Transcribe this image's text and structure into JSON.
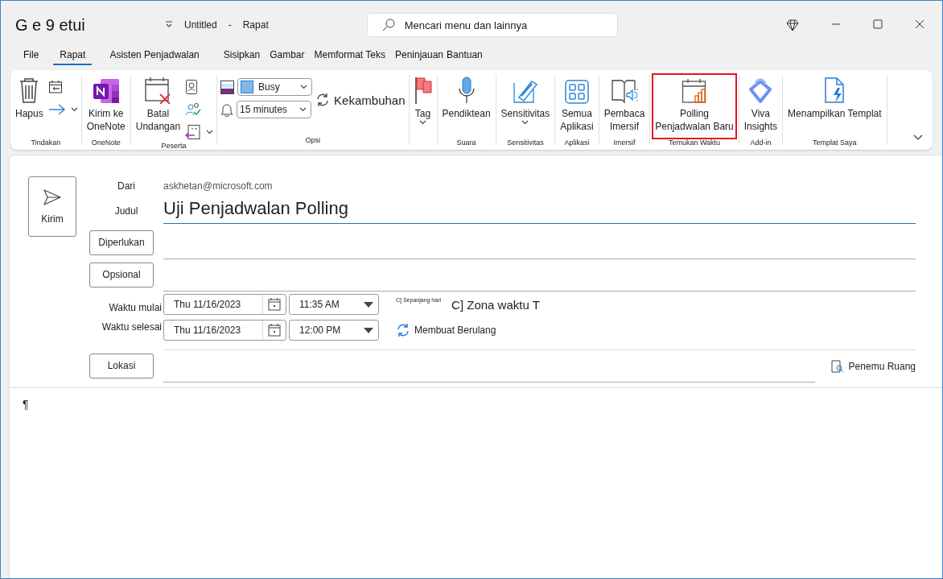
{
  "window": {
    "title": "G e 9 etui",
    "document": "Untitled",
    "separator": "-",
    "type": "Rapat"
  },
  "search": {
    "placeholder": "Mencari menu dan lainnya"
  },
  "tabs": [
    {
      "label": "File",
      "selected": false
    },
    {
      "label": "Rapat",
      "selected": true
    },
    {
      "label": "Asisten Penjadwalan",
      "selected": false
    },
    {
      "label": "Sisipkan",
      "selected": false
    },
    {
      "label": "Gambar",
      "selected": false
    },
    {
      "label": "Memformat Teks",
      "selected": false
    },
    {
      "label": "Peninjauan",
      "selected": false
    },
    {
      "label": "Bantuan",
      "selected": false
    }
  ],
  "ribbon": {
    "groups": [
      {
        "label": "Tindakan",
        "items": [
          {
            "kind": "large",
            "label": "Hapus",
            "caret": false,
            "highlighted": false
          },
          {
            "kind": "stack",
            "items": [
              {
                "kind": "small",
                "caret": false
              },
              {
                "kind": "small",
                "caret": true
              }
            ]
          }
        ]
      },
      {
        "label": "OneNote",
        "items": [
          {
            "kind": "large",
            "label": "Kirim ke\nOneNote",
            "caret": false,
            "highlighted": false
          }
        ]
      },
      {
        "label": "Peserta",
        "items": [
          {
            "kind": "large",
            "label": "Batal\nUndangan",
            "caret": false,
            "highlighted": false
          },
          {
            "kind": "stack",
            "items": [
              {
                "kind": "small",
                "caret": false
              },
              {
                "kind": "small",
                "caret": false
              },
              {
                "kind": "small",
                "caret": true
              }
            ]
          }
        ]
      },
      {
        "label": "Opsi",
        "items": [
          {
            "kind": "stack",
            "items": [
              {
                "kind": "dropdown",
                "value": "Busy",
                "swatch": true
              },
              {
                "kind": "dropdown",
                "value": "15 minutes",
                "swatch": false
              }
            ]
          },
          {
            "kind": "text",
            "label": "Kekambuhan"
          }
        ]
      },
      {
        "items": [
          {
            "kind": "large",
            "label": "Tag",
            "caret": true,
            "highlighted": false
          }
        ]
      },
      {
        "label": "Suara",
        "items": [
          {
            "kind": "large",
            "label": "Pendiktean",
            "caret": false,
            "highlighted": false
          }
        ]
      },
      {
        "label": "Sensitivitas",
        "items": [
          {
            "kind": "large",
            "label": "Sensitivitas",
            "caret": true,
            "highlighted": false
          }
        ]
      },
      {
        "label": "Aplikasi",
        "items": [
          {
            "kind": "large",
            "label": "Semua\nAplikasi",
            "caret": false,
            "highlighted": false
          }
        ]
      },
      {
        "label": "Imersif",
        "items": [
          {
            "kind": "large",
            "label": "Pembaca\nImersif",
            "caret": false,
            "highlighted": false
          }
        ]
      },
      {
        "label": "Temukan Waktu",
        "items": [
          {
            "kind": "large",
            "label": "Polling\nPenjadwalan Baru",
            "caret": false,
            "highlighted": true
          }
        ]
      },
      {
        "label": "Add-in",
        "items": [
          {
            "kind": "large",
            "label": "Viva\nInsights",
            "caret": false,
            "highlighted": false
          }
        ]
      },
      {
        "label": "Templat Saya",
        "items": [
          {
            "kind": "large",
            "label": "Menampilkan Templat",
            "caret": false,
            "highlighted": false
          }
        ]
      }
    ]
  },
  "form": {
    "send": "Kirim",
    "from_label": "Dari",
    "from": "askhetan@microsoft.com",
    "subject_label": "Judul",
    "subject": "Uji Penjadwalan Polling",
    "required": "Diperlukan",
    "optional": "Opsional",
    "start_label": "Waktu mulai",
    "start_date": "Thu 11/16/2023",
    "start_time": "11:35 AM",
    "all_day": {
      "label": "C] Sepanjang hari",
      "checked": false
    },
    "time_zone": {
      "label": "C] Zona waktu T",
      "checked": false
    },
    "end_label": "Waktu selesai",
    "end_date": "Thu 11/16/2023",
    "end_time": "12:00 PM",
    "recurrence": "Membuat Berulang",
    "location": "Lokasi",
    "room_finder": "Penemu Ruang"
  },
  "body": {
    "text": "¶"
  }
}
